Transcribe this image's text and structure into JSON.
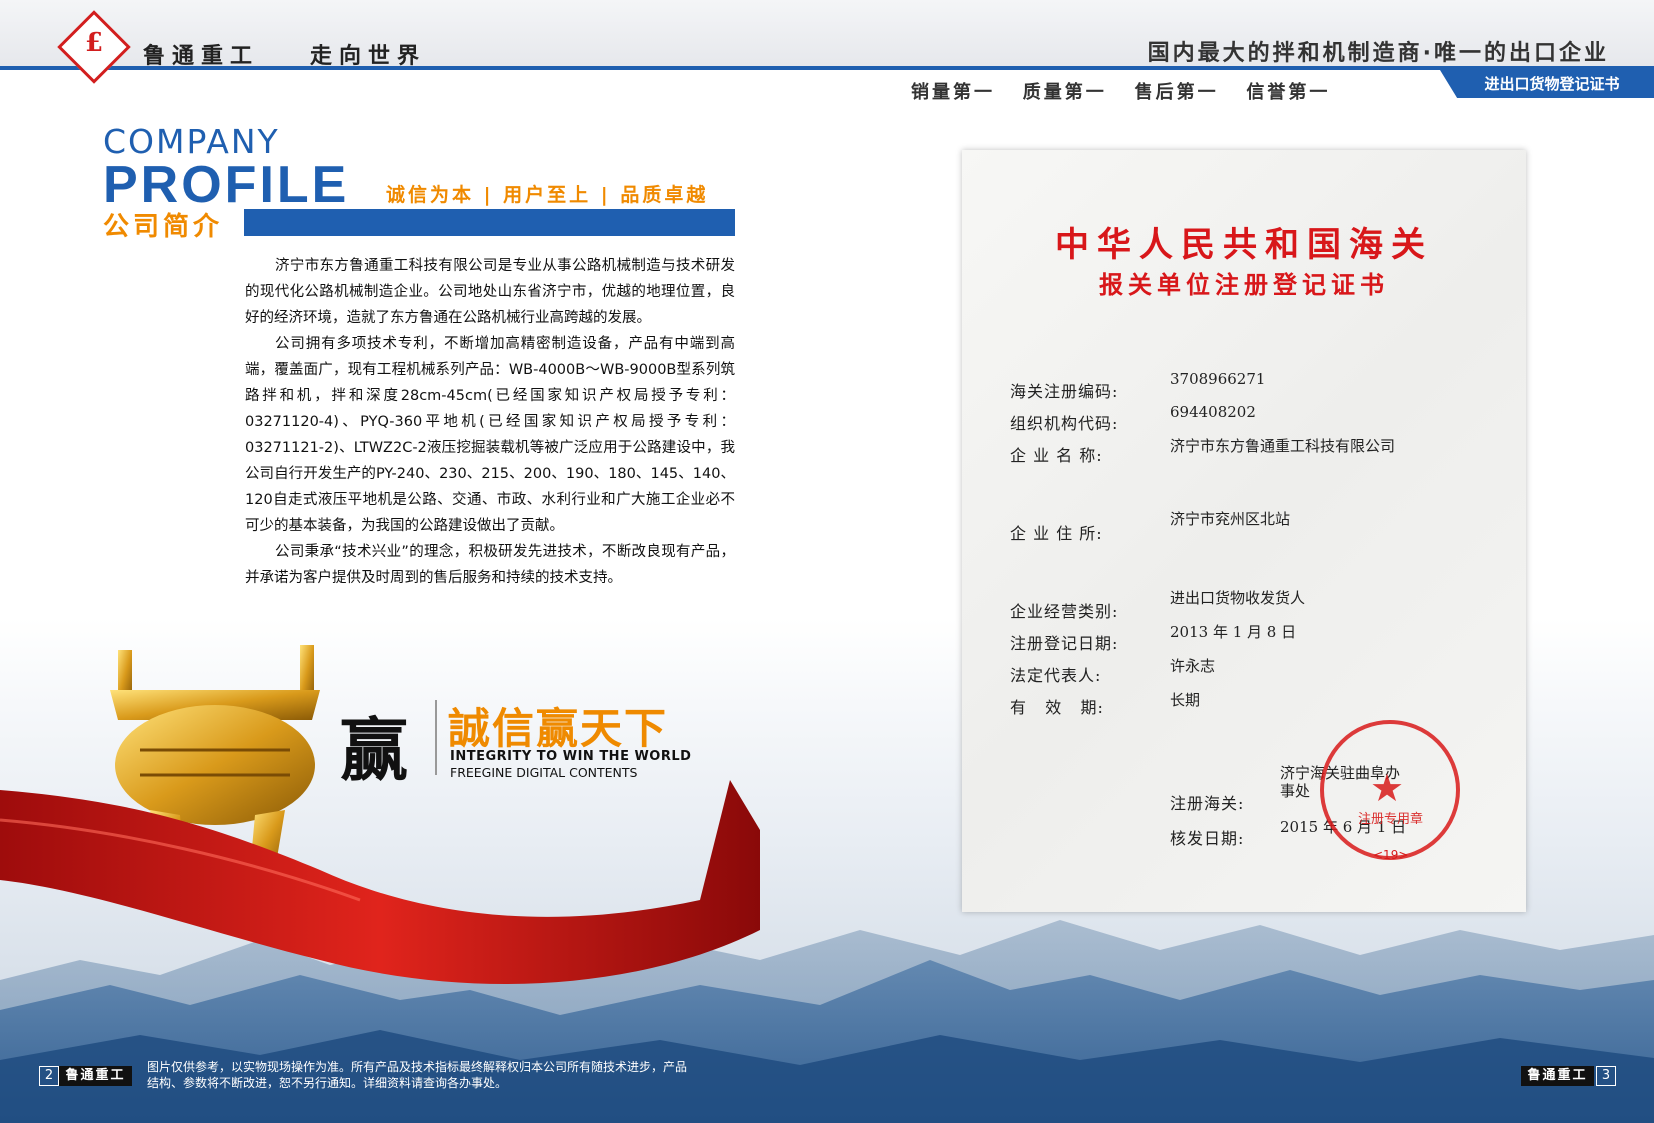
{
  "header": {
    "logo_glyph": "£",
    "brand": "鲁通重工",
    "brand_slogan": "走向世界",
    "top_slogan": "国内最大的拌和机制造商·唯一的出口企业",
    "sub_slogan": "销量第一   质量第一   售后第一   信誉第一",
    "tag": "进出口货物登记证书"
  },
  "profile": {
    "company": "COMPANY",
    "profile": "PROFILE",
    "cn_title": "公司简介",
    "motto": "诚信为本 | 用户至上 | 品质卓越"
  },
  "body": {
    "p1": "济宁市东方鲁通重工科技有限公司是专业从事公路机械制造与技术研发的现代化公路机械制造企业。公司地处山东省济宁市，优越的地理位置，良好的经济环境，造就了东方鲁通在公路机械行业高跨越的发展。",
    "p2": "公司拥有多项技术专利，不断增加高精密制造设备，产品有中端到高端，覆盖面广，现有工程机械系列产品：WB-4000B～WB-9000B型系列筑路拌和机，拌和深度28cm-45cm(已经国家知识产权局授予专利：03271120-4)、PYQ-360平地机(已经国家知识产权局授予专利：03271121-2)、LTWZ2C-2液压挖掘装载机等被广泛应用于公路建设中，我公司自行开发生产的PY-240、230、215、200、190、180、145、140、120自走式液压平地机是公路、交通、市政、水利行业和广大施工企业必不可少的基本装备，为我国的公路建设做出了贡献。",
    "p3": "公司秉承“技术兴业”的理念，积极研发先进技术，不断改良现有产品，并承诺为客户提供及时周到的售后服务和持续的技术支持。"
  },
  "slogan_block": {
    "char": "赢",
    "title": "誠信赢天下",
    "en1": "INTEGRITY TO WIN THE WORLD",
    "en2": "FREEGINE DIGITAL CONTENTS"
  },
  "footer": {
    "page_left": "2",
    "page_right": "3",
    "brand": "鲁通重工",
    "note": "图片仅供参考，以实物现场操作为准。所有产品及技术指标最终解释权归本公司所有随技术进步，产品结构、参数将不断改进，恕不另行通知。详细资料请查询各办事处。"
  },
  "certificate": {
    "title": "中华人民共和国海关",
    "subtitle": "报关单位注册登记证书",
    "rows": [
      {
        "label": "海关注册编码:",
        "value": "3708966271"
      },
      {
        "label": "组织机构代码:",
        "value": "694408202"
      },
      {
        "label": "企 业 名 称:",
        "value": "济宁市东方鲁通重工科技有限公司"
      },
      {
        "label": "企 业 住 所:",
        "value": "济宁市兖州区北站"
      },
      {
        "label": "企业经营类别:",
        "value": "进出口货物收发货人"
      },
      {
        "label": "注册登记日期:",
        "value": "2013 年 1 月 8 日"
      },
      {
        "label": "法定代表人:",
        "value": "许永志"
      },
      {
        "label": "有   效   期:",
        "value": "长期"
      }
    ],
    "reg_customs_label": "注册海关:",
    "reg_customs_value1": "济宁海关驻曲阜办",
    "reg_customs_value2": "事处",
    "issue_label": "核发日期:",
    "issue_value": "2015 年 6 月 1 日",
    "seal_text": "注册专用章",
    "seal_num": "<19>"
  },
  "colors": {
    "brand_blue": "#1f5fb0",
    "accent_orange": "#f08a00",
    "seal_red": "#d8171a"
  }
}
